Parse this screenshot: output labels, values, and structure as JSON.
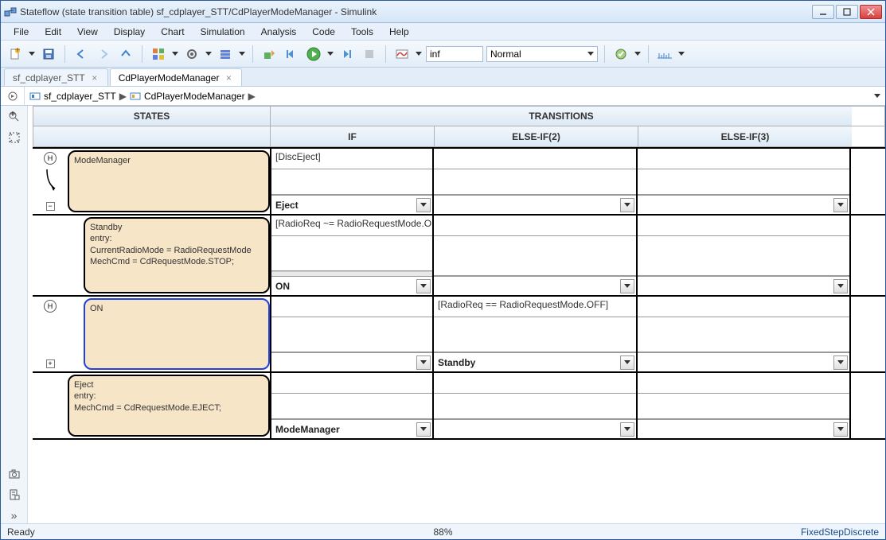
{
  "window": {
    "title": "Stateflow (state transition table) sf_cdplayer_STT/CdPlayerModeManager - Simulink"
  },
  "menu": {
    "items": [
      "File",
      "Edit",
      "View",
      "Display",
      "Chart",
      "Simulation",
      "Analysis",
      "Code",
      "Tools",
      "Help"
    ]
  },
  "toolbar": {
    "sim_time": "inf",
    "sim_mode": "Normal"
  },
  "tabs": {
    "items": [
      {
        "label": "sf_cdplayer_STT",
        "active": false
      },
      {
        "label": "CdPlayerModeManager",
        "active": true
      }
    ]
  },
  "breadcrumb": {
    "items": [
      "sf_cdplayer_STT",
      "CdPlayerModeManager"
    ]
  },
  "headers": {
    "states": "STATES",
    "transitions": "TRANSITIONS",
    "if": "IF",
    "elseif2": "ELSE-IF(2)",
    "elseif3": "ELSE-IF(3)"
  },
  "rows": [
    {
      "history_badge": "H",
      "expander": "-",
      "state_text": "ModeManager",
      "if_cond": "[DiscEject]",
      "if_dest": "Eject",
      "elif2_cond": "",
      "elif2_dest": "",
      "elif3_cond": "",
      "elif3_dest": ""
    },
    {
      "history_badge": "",
      "expander": "",
      "state_text": "Standby\nentry:\nCurrentRadioMode = RadioRequestMode\nMechCmd = CdRequestMode.STOP;",
      "if_cond": "[RadioReq ~= RadioRequestMode.O",
      "if_dest": "ON",
      "elif2_cond": "",
      "elif2_dest": "",
      "elif3_cond": "",
      "elif3_dest": ""
    },
    {
      "history_badge": "H",
      "expander": "+",
      "state_text": "ON",
      "selected": true,
      "if_cond": "",
      "if_dest": "",
      "elif2_cond": "[RadioReq == RadioRequestMode.OFF]",
      "elif2_dest": "Standby",
      "elif3_cond": "",
      "elif3_dest": ""
    },
    {
      "history_badge": "",
      "expander": "",
      "state_text": "Eject\nentry:\nMechCmd = CdRequestMode.EJECT;",
      "if_cond": "",
      "if_dest": "ModeManager",
      "elif2_cond": "",
      "elif2_dest": "",
      "elif3_cond": "",
      "elif3_dest": ""
    }
  ],
  "status": {
    "left": "Ready",
    "mid": "88%",
    "right": "FixedStepDiscrete"
  }
}
